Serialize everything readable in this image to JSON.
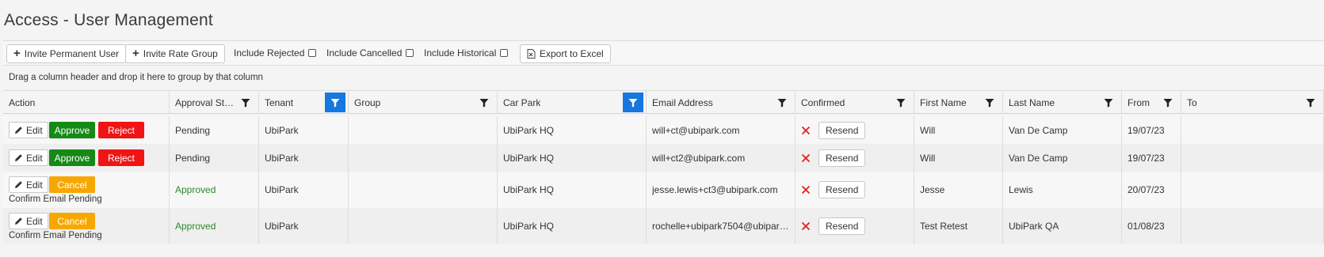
{
  "page": {
    "title": "Access - User Management"
  },
  "toolbar": {
    "invite_permanent": "Invite Permanent User",
    "invite_rate_group": "Invite Rate Group",
    "include_rejected": "Include Rejected",
    "include_cancelled": "Include Cancelled",
    "include_historical": "Include Historical",
    "export": "Export to Excel"
  },
  "grid": {
    "group_hint": "Drag a column header and drop it here to group by that column",
    "columns": [
      {
        "label": "Action",
        "filter": false,
        "active": false
      },
      {
        "label": "Approval Status",
        "filter": true,
        "active": false
      },
      {
        "label": "Tenant",
        "filter": true,
        "active": true
      },
      {
        "label": "Group",
        "filter": true,
        "active": false
      },
      {
        "label": "Car Park",
        "filter": true,
        "active": true
      },
      {
        "label": "Email Address",
        "filter": true,
        "active": false
      },
      {
        "label": "Confirmed",
        "filter": true,
        "active": false
      },
      {
        "label": "First Name",
        "filter": true,
        "active": false
      },
      {
        "label": "Last Name",
        "filter": true,
        "active": false
      },
      {
        "label": "From",
        "filter": true,
        "active": false
      },
      {
        "label": "To",
        "filter": true,
        "active": false
      }
    ],
    "action_labels": {
      "edit": "Edit",
      "approve": "Approve",
      "reject": "Reject",
      "cancel": "Cancel",
      "resend": "Resend"
    },
    "rows": [
      {
        "status": "Pending",
        "tenant": "UbiPark",
        "group": "",
        "car_park": "UbiPark HQ",
        "email": "will+ct@ubipark.com",
        "confirmed": false,
        "first_name": "Will",
        "last_name": "Van De Camp",
        "from": "19/07/23",
        "to": "",
        "actions": "approve_reject",
        "note": ""
      },
      {
        "status": "Pending",
        "tenant": "UbiPark",
        "group": "",
        "car_park": "UbiPark HQ",
        "email": "will+ct2@ubipark.com",
        "confirmed": false,
        "first_name": "Will",
        "last_name": "Van De Camp",
        "from": "19/07/23",
        "to": "",
        "actions": "approve_reject",
        "note": ""
      },
      {
        "status": "Approved",
        "tenant": "UbiPark",
        "group": "",
        "car_park": "UbiPark HQ",
        "email": "jesse.lewis+ct3@ubipark.com",
        "confirmed": false,
        "first_name": "Jesse",
        "last_name": "Lewis",
        "from": "20/07/23",
        "to": "",
        "actions": "cancel",
        "note": "Confirm Email Pending"
      },
      {
        "status": "Approved",
        "tenant": "UbiPark",
        "group": "",
        "car_park": "UbiPark HQ",
        "email": "rochelle+ubipark7504@ubipark...",
        "confirmed": false,
        "first_name": "Test Retest",
        "last_name": "UbiPark QA",
        "from": "01/08/23",
        "to": "",
        "actions": "cancel",
        "note": "Confirm Email Pending"
      }
    ]
  },
  "colors": {
    "approve": "#158a16",
    "reject": "#f01414",
    "cancel": "#f7a800",
    "filter_active": "#1677e0",
    "approved_text": "#2a8a2a"
  },
  "icons": {
    "edit": "pencil-icon",
    "filter": "funnel-icon",
    "unconfirmed": "x-icon",
    "export": "excel-icon"
  }
}
